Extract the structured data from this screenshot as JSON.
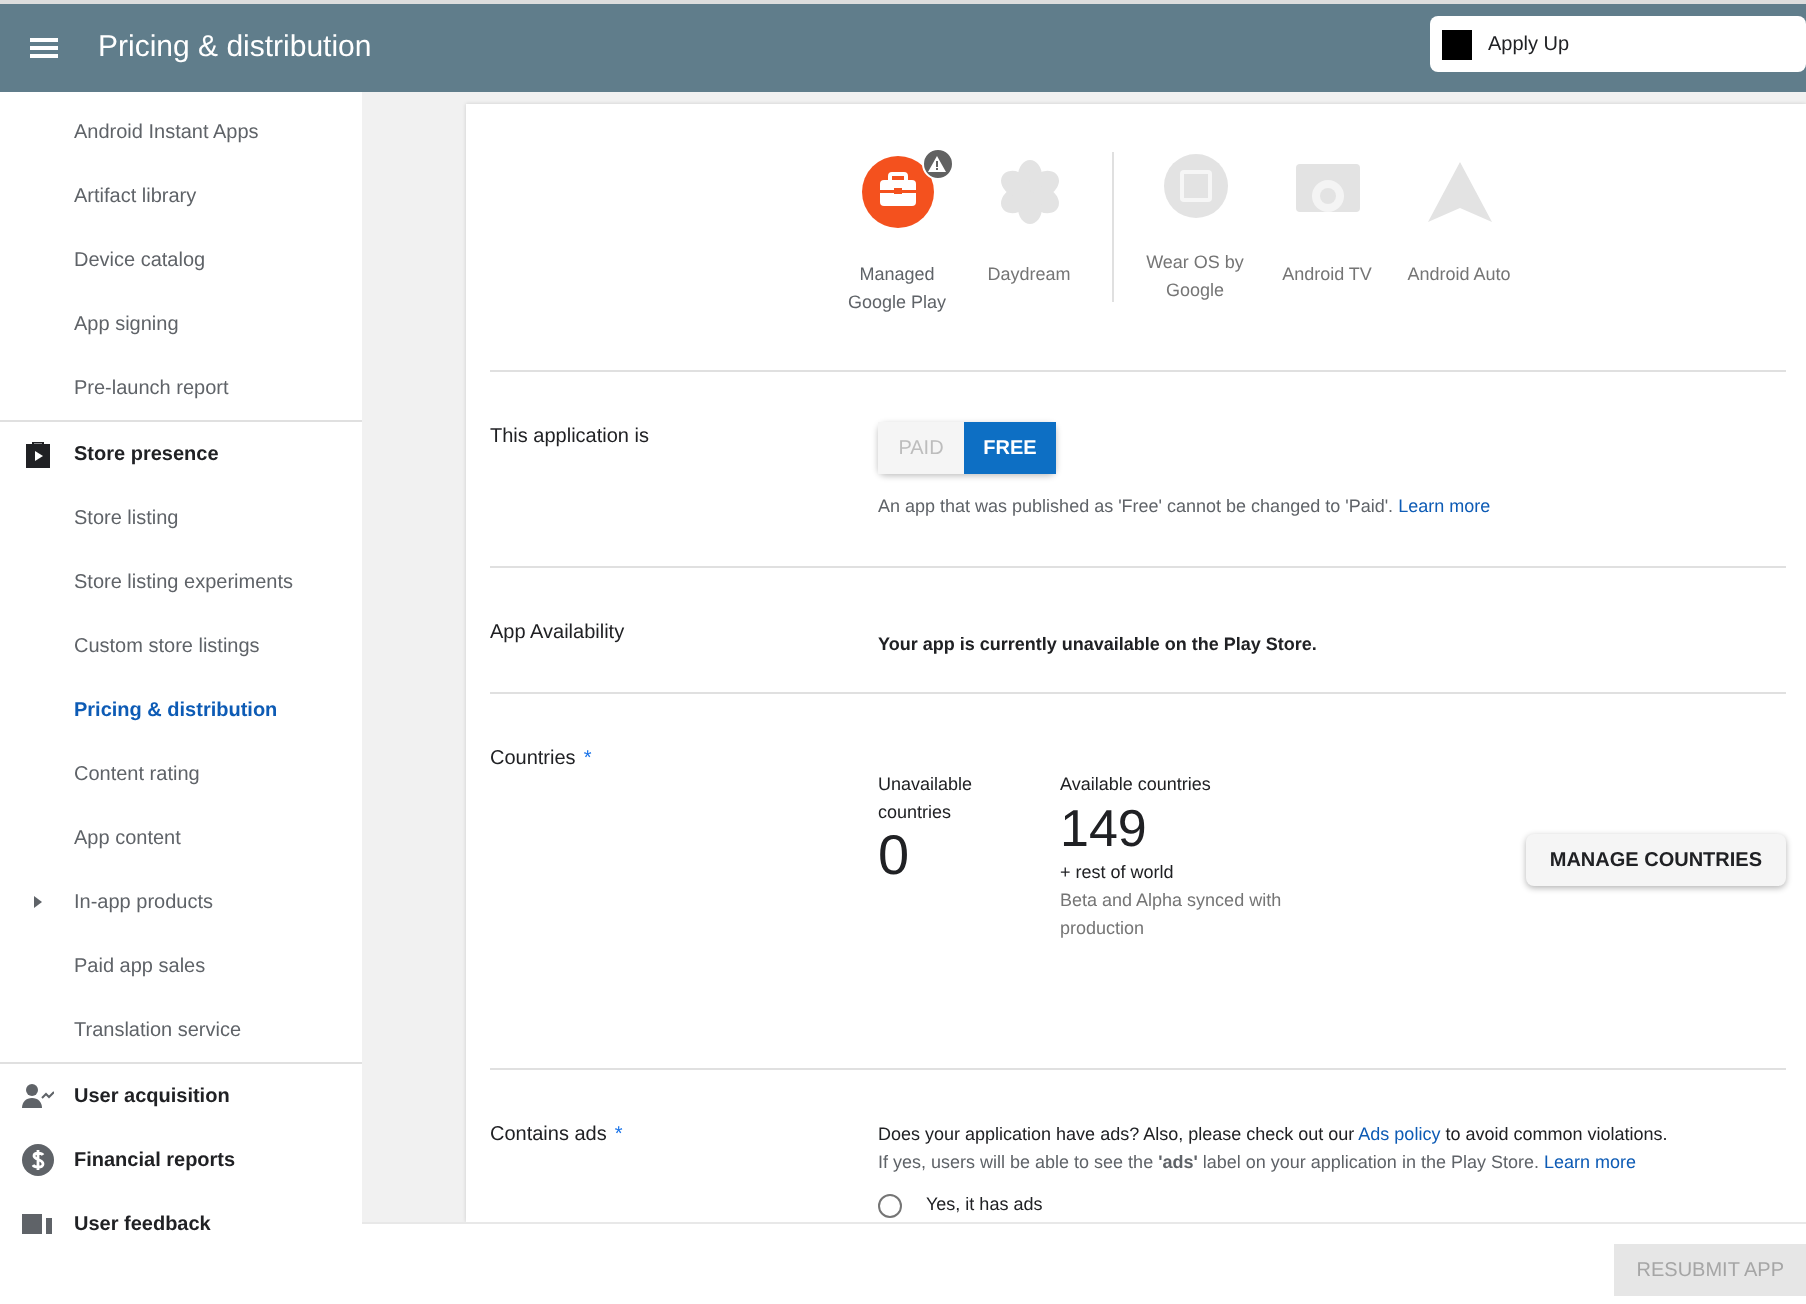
{
  "top_bar": {
    "title": "Pricing & distribution",
    "app_name": "Apply Up"
  },
  "sidebar": {
    "items": [
      {
        "label": "Android Instant Apps",
        "kind": "sub",
        "selected": false
      },
      {
        "label": "Artifact library",
        "kind": "sub",
        "selected": false
      },
      {
        "label": "Device catalog",
        "kind": "sub",
        "selected": false
      },
      {
        "label": "App signing",
        "kind": "sub",
        "selected": false
      },
      {
        "label": "Pre-launch report",
        "kind": "sub",
        "selected": false
      },
      {
        "label": "Store presence",
        "kind": "section",
        "selected": false
      },
      {
        "label": "Store listing",
        "kind": "sub",
        "selected": false
      },
      {
        "label": "Store listing experiments",
        "kind": "sub",
        "selected": false
      },
      {
        "label": "Custom store listings",
        "kind": "sub",
        "selected": false
      },
      {
        "label": "Pricing & distribution",
        "kind": "sub",
        "selected": true
      },
      {
        "label": "Content rating",
        "kind": "sub",
        "selected": false
      },
      {
        "label": "App content",
        "kind": "sub",
        "selected": false
      },
      {
        "label": "In-app products",
        "kind": "sub",
        "selected": false,
        "expanded": false
      },
      {
        "label": "Paid app sales",
        "kind": "sub",
        "selected": false
      },
      {
        "label": "Translation service",
        "kind": "sub",
        "selected": false
      },
      {
        "label": "User acquisition",
        "kind": "section",
        "selected": false
      },
      {
        "label": "Financial reports",
        "kind": "section",
        "selected": false
      },
      {
        "label": "User feedback",
        "kind": "section",
        "selected": false
      }
    ]
  },
  "devices": [
    {
      "label": "Managed Google Play",
      "enabled": true,
      "warning": true
    },
    {
      "label": "Daydream",
      "enabled": false,
      "warning": false
    },
    {
      "label": "Wear OS by Google",
      "enabled": false,
      "warning": false
    },
    {
      "label": "Android TV",
      "enabled": false,
      "warning": false
    },
    {
      "label": "Android Auto",
      "enabled": false,
      "warning": false
    }
  ],
  "pricing": {
    "label": "This application is",
    "options": [
      {
        "label": "PAID",
        "selected": false
      },
      {
        "label": "FREE",
        "selected": true
      }
    ],
    "note": "An app that was published as 'Free' cannot be changed to 'Paid'.",
    "link": "Learn more"
  },
  "availability": {
    "label": "App Availability",
    "message": "Your app is currently unavailable on the Play Store."
  },
  "countries": {
    "label": "Countries",
    "required_mark": "*",
    "unavailable_label": "Unavailable countries",
    "unavailable_count": "0",
    "available_label": "Available countries",
    "available_count": "149",
    "rest_of_world": "+ rest of world",
    "sync_note": "Beta and Alpha synced with production",
    "button": "MANAGE COUNTRIES"
  },
  "ads": {
    "label": "Contains ads",
    "required_mark": "*",
    "question_before": "Does your application have ads? Also, please check out our",
    "policy_link": "Ads policy",
    "question_after": "to avoid common violations.",
    "hint": "If yes, users will be able to see the **'ads'** label on your application in the Play Store.",
    "hint_link": "Learn more",
    "options": [
      {
        "label": "Yes, it has ads",
        "selected": false
      }
    ]
  },
  "footer": {
    "button": "RESUBMIT APP",
    "disabled": true
  }
}
